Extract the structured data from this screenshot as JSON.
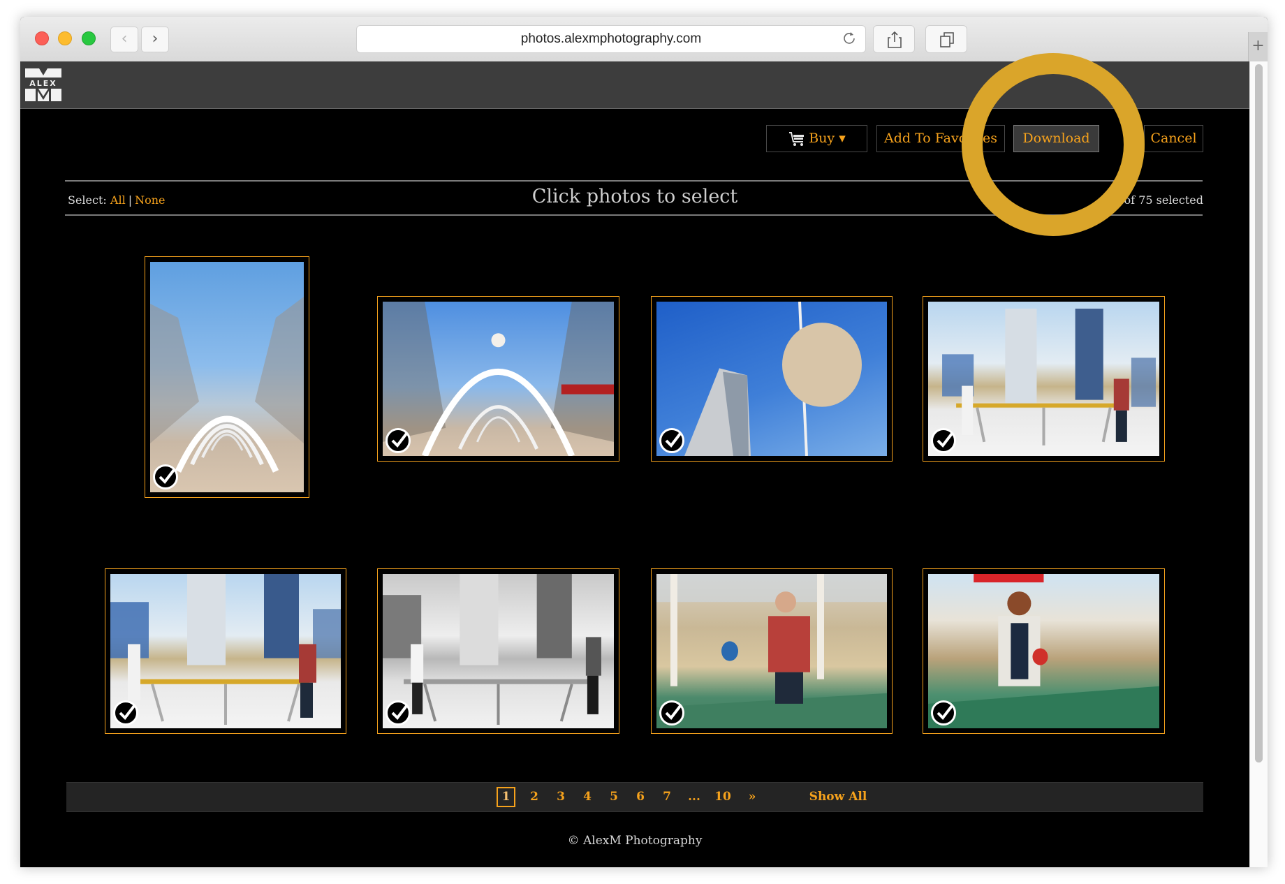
{
  "browser": {
    "url": "photos.alexmphotography.com",
    "back_label": "‹",
    "forward_label": "›",
    "new_tab_label": "+"
  },
  "site": {
    "logo_text": "ALEX M"
  },
  "actions": {
    "buy_label": "Buy ▾",
    "favorites_label": "Add To Favorites",
    "download_label": "Download",
    "cancel_label": "Cancel"
  },
  "selection": {
    "select_prefix": "Select:",
    "all_label": "All",
    "separator": "|",
    "none_label": "None",
    "title": "Click photos to select",
    "count_text": "of 75 selected"
  },
  "photos": [
    {
      "alt": "White arches walkway with bare trees (portrait)",
      "selected": true
    },
    {
      "alt": "White arches walkway with hanging globe lights",
      "selected": true
    },
    {
      "alt": "Skyscraper and spherical lamp against blue sky",
      "selected": true
    },
    {
      "alt": "Couple playing ping pong in city park",
      "selected": true
    },
    {
      "alt": "Couple playing ping pong, wider view",
      "selected": true
    },
    {
      "alt": "Couple playing ping pong, black and white",
      "selected": true
    },
    {
      "alt": "Man in plaid shirt returning ping pong ball",
      "selected": true
    },
    {
      "alt": "Woman holding ping pong paddle",
      "selected": true
    }
  ],
  "pagination": {
    "pages": [
      "1",
      "2",
      "3",
      "4",
      "5",
      "6",
      "7",
      "...",
      "10"
    ],
    "current": "1",
    "next_label": "»",
    "show_all_label": "Show All"
  },
  "footer": {
    "text": "© AlexM Photography"
  },
  "colors": {
    "accent": "#f6a21c",
    "annotation": "#daa52a",
    "header_bg": "#3d3d3d",
    "page_bg": "#000000"
  }
}
